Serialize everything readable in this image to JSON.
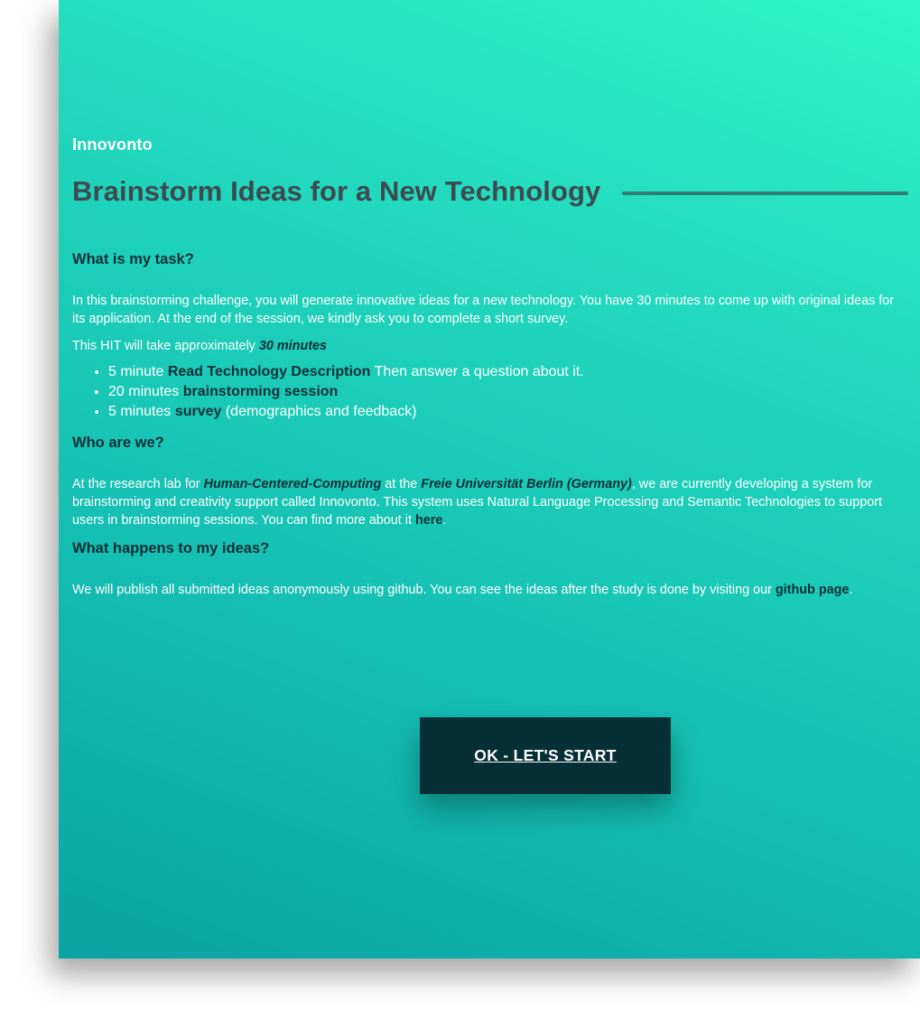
{
  "brand": "Innovonto",
  "title": "Brainstorm Ideas for a New Technology",
  "task": {
    "heading": "What is my task?",
    "intro": "In this brainstorming challenge, you will generate innovative ideas for a new technology. You have 30 minutes to come up with original ideas for its application. At the end of the session, we kindly ask you to complete a short survey.",
    "duration_prefix": "This HIT will take approximately ",
    "duration_value": "30 minutes",
    "steps": [
      {
        "pre": "5 minute ",
        "bold": "Read Technology Description",
        "post": " Then answer a question about it."
      },
      {
        "pre": "20 minutes ",
        "bold": "brainstorming session",
        "post": ""
      },
      {
        "pre": "5 minutes ",
        "bold": "survey",
        "post": " (demographics and feedback)"
      }
    ]
  },
  "who": {
    "heading": "Who are we?",
    "text_1": "At the research lab for ",
    "lab": "Human-Centered-Computing",
    "text_2": " at the ",
    "university": "Freie Universität Berlin (Germany)",
    "text_3": ", we are currently developing a system for brainstorming and creativity support called Innovonto. This system uses Natural Language Processing and Semantic Technologies to support users in brainstorming sessions. You can find more about it ",
    "link_label": "here",
    "text_4": "."
  },
  "ideas": {
    "heading": "What happens to my ideas?",
    "text_1": "We will publish all submitted ideas anonymously using github. You can see the ideas after the study is done by visiting our ",
    "link_label": "github page",
    "text_2": "."
  },
  "start_button_label": "OK - LET'S START",
  "colors": {
    "card_gradient_light": "#2ef5c8",
    "card_gradient_dark": "#0aa3a3",
    "title_text": "#3d4a4f",
    "heading_text": "#0e2f35",
    "button_bg": "#072f36"
  }
}
